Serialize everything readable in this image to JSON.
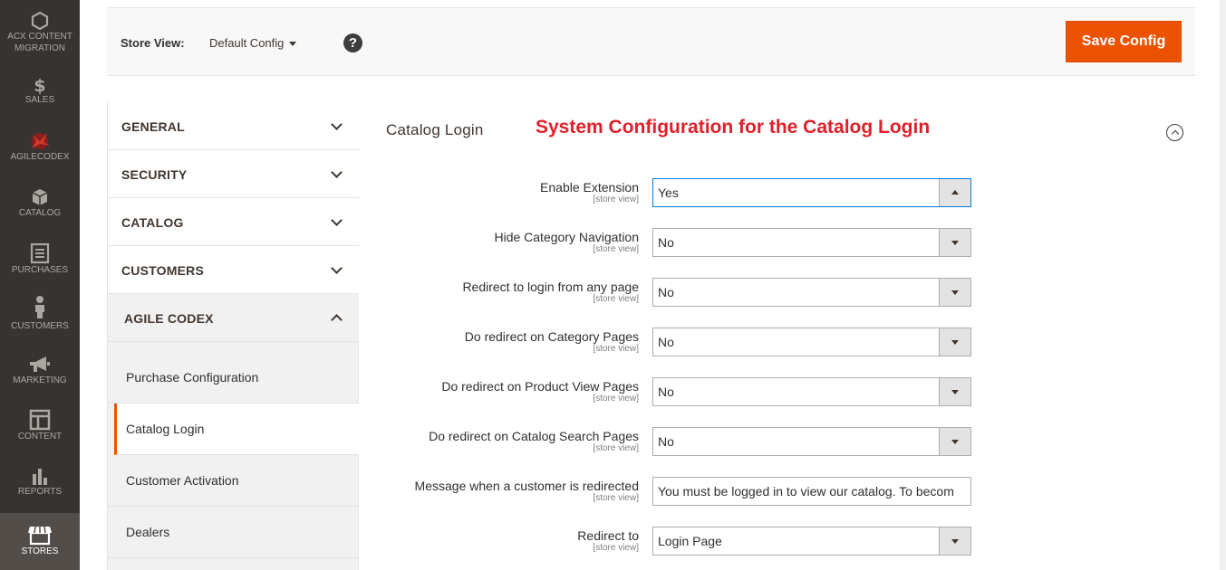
{
  "menu": [
    {
      "label_1": "ACX CONTENT",
      "label_2": "MIGRATION",
      "icon": "hexagon-icon"
    },
    {
      "label_1": "SALES",
      "icon": "dollar-icon"
    },
    {
      "label_1": "AGILECODEX",
      "icon": "agilecodex-logo-icon"
    },
    {
      "label_1": "CATALOG",
      "icon": "cube-icon"
    },
    {
      "label_1": "PURCHASES",
      "icon": "document-icon"
    },
    {
      "label_1": "CUSTOMERS",
      "icon": "person-icon"
    },
    {
      "label_1": "MARKETING",
      "icon": "megaphone-icon"
    },
    {
      "label_1": "CONTENT",
      "icon": "layout-icon"
    },
    {
      "label_1": "REPORTS",
      "icon": "bar-chart-icon"
    },
    {
      "label_1": "STORES",
      "icon": "storefront-icon"
    }
  ],
  "store_bar": {
    "label": "Store View:",
    "selected": "Default Config",
    "help": "?",
    "save_label": "Save Config"
  },
  "tabs": {
    "groups": [
      "GENERAL",
      "SECURITY",
      "CATALOG",
      "CUSTOMERS",
      "AGILE CODEX"
    ],
    "items": [
      "Purchase Configuration",
      "Catalog Login",
      "Customer Activation",
      "Dealers"
    ]
  },
  "section": {
    "title": "Catalog Login",
    "annotation": "System Configuration for the Catalog Login"
  },
  "scope": "[store view]",
  "fields": [
    {
      "label": "Enable Extension",
      "value": "Yes"
    },
    {
      "label": "Hide Category Navigation",
      "value": "No"
    },
    {
      "label": "Redirect to login from any page",
      "value": "No"
    },
    {
      "label": "Do redirect on Category Pages",
      "value": "No"
    },
    {
      "label": "Do redirect on Product View Pages",
      "value": "No"
    },
    {
      "label": "Do redirect on Catalog Search Pages",
      "value": "No"
    },
    {
      "label": "Message when a customer is redirected",
      "value": "You must be logged in to view our catalog. To becom"
    },
    {
      "label": "Redirect to",
      "value": "Login Page"
    }
  ],
  "colors": {
    "accent": "#eb5202",
    "sidebar": "#373330",
    "annotation": "#e0202a"
  }
}
